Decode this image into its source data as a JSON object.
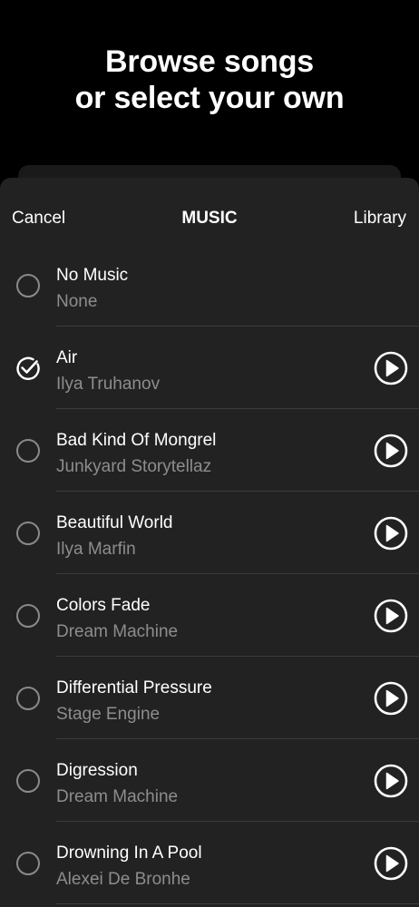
{
  "headline": {
    "line1": "Browse songs",
    "line2": "or select your own"
  },
  "navbar": {
    "cancel": "Cancel",
    "title": "MUSIC",
    "library": "Library"
  },
  "colors": {
    "background": "#000000",
    "sheet": "#222222",
    "divider": "#3c3c3c",
    "primary_text": "#ffffff",
    "secondary_text": "#8d8d8d",
    "radio_border": "#8a8a8a"
  },
  "songs": [
    {
      "title": "No Music",
      "artist": "None",
      "selected": false,
      "has_play": false,
      "radio_icon": "radio-empty-icon"
    },
    {
      "title": "Air",
      "artist": "Ilya Truhanov",
      "selected": true,
      "has_play": true,
      "radio_icon": "checkmark-circle-icon"
    },
    {
      "title": "Bad Kind Of Mongrel",
      "artist": "Junkyard Storytellaz",
      "selected": false,
      "has_play": true,
      "radio_icon": "radio-empty-icon"
    },
    {
      "title": "Beautiful World",
      "artist": "Ilya Marfin",
      "selected": false,
      "has_play": true,
      "radio_icon": "radio-empty-icon"
    },
    {
      "title": "Colors Fade",
      "artist": "Dream Machine",
      "selected": false,
      "has_play": true,
      "radio_icon": "radio-empty-icon"
    },
    {
      "title": "Differential Pressure",
      "artist": "Stage Engine",
      "selected": false,
      "has_play": true,
      "radio_icon": "radio-empty-icon"
    },
    {
      "title": "Digression",
      "artist": "Dream Machine",
      "selected": false,
      "has_play": true,
      "radio_icon": "radio-empty-icon"
    },
    {
      "title": "Drowning In A Pool",
      "artist": "Alexei De Bronhe",
      "selected": false,
      "has_play": true,
      "radio_icon": "radio-empty-icon"
    }
  ]
}
